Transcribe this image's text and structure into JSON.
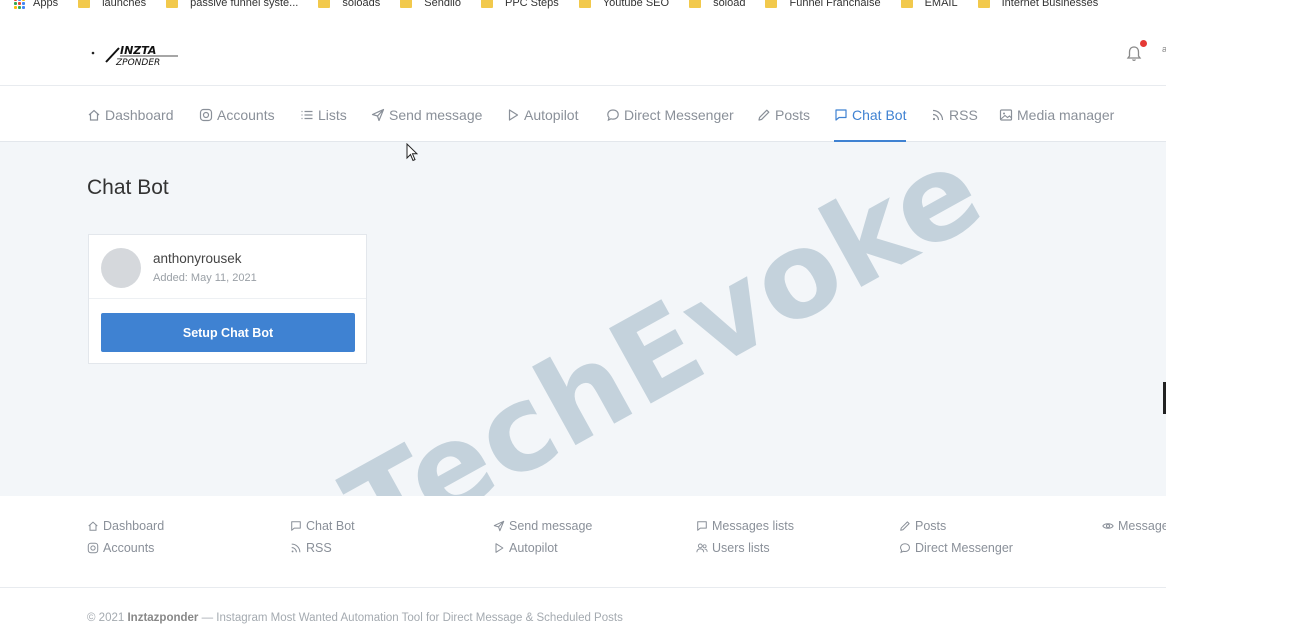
{
  "bookmarks": {
    "apps_label": "Apps",
    "items": [
      "launches",
      "passive funnel syste...",
      "soloads",
      "Sendilo",
      "PPC Steps",
      "Youtube SEO",
      "soload",
      "Funnel Franchaise",
      "EMAIL",
      "Internet Businesses"
    ]
  },
  "header": {
    "logo_text_top": "INZTA",
    "logo_text_bottom": "ZPONDER",
    "user_initial": "a"
  },
  "nav": {
    "items": [
      {
        "label": "Dashboard",
        "icon": "home-icon"
      },
      {
        "label": "Accounts",
        "icon": "instagram-icon"
      },
      {
        "label": "Lists",
        "icon": "list-icon"
      },
      {
        "label": "Send message",
        "icon": "send-icon"
      },
      {
        "label": "Autopilot",
        "icon": "play-icon"
      },
      {
        "label": "Direct Messenger",
        "icon": "chat-bubble-icon"
      },
      {
        "label": "Posts",
        "icon": "pencil-icon"
      },
      {
        "label": "Chat Bot",
        "icon": "message-square-icon"
      },
      {
        "label": "RSS",
        "icon": "rss-icon"
      },
      {
        "label": "Media manager",
        "icon": "image-icon"
      }
    ],
    "active": "Chat Bot"
  },
  "main": {
    "title": "Chat Bot",
    "card": {
      "username": "anthonyrousek",
      "added": "Added: May 11, 2021",
      "button_label": "Setup Chat Bot"
    },
    "watermark": "TechEvoke"
  },
  "footer": {
    "links": [
      {
        "label": "Dashboard",
        "icon": "home-icon"
      },
      {
        "label": "Accounts",
        "icon": "instagram-icon"
      },
      {
        "label": "Chat Bot",
        "icon": "message-square-icon"
      },
      {
        "label": "RSS",
        "icon": "rss-icon"
      },
      {
        "label": "Send message",
        "icon": "send-icon"
      },
      {
        "label": "Autopilot",
        "icon": "play-icon"
      },
      {
        "label": "Messages lists",
        "icon": "message-square-icon"
      },
      {
        "label": "Users lists",
        "icon": "users-icon"
      },
      {
        "label": "Posts",
        "icon": "pencil-icon"
      },
      {
        "label": "Direct Messenger",
        "icon": "chat-bubble-icon"
      },
      {
        "label": "Message",
        "icon": "eye-icon"
      }
    ],
    "copyright_prefix": "© 2021",
    "copyright_brand": "Inztazponder",
    "copyright_rest": "— Instagram Most Wanted Automation Tool for Direct Message & Scheduled Posts"
  },
  "colors": {
    "accent": "#3f82d2",
    "bell_dot": "#e53935",
    "main_bg": "#f3f6f9",
    "watermark": "#c4d2dc"
  }
}
